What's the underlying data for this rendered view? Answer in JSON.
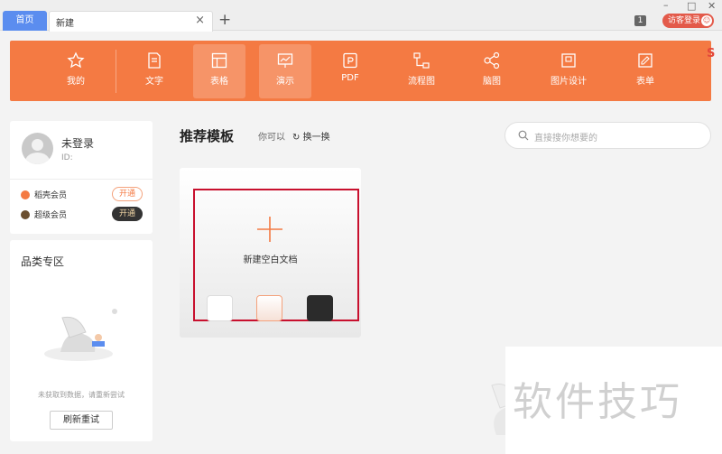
{
  "tabs": {
    "home": "首页",
    "new": "新建",
    "close": "×",
    "add": "+"
  },
  "window": {
    "badge": "1",
    "guest_label": "访客登录",
    "guest_icon": "user-icon",
    "minimize": "–",
    "maximize": "□",
    "close": "✕"
  },
  "toolbar": {
    "bg_color": "#f47a43",
    "items": [
      {
        "label": "我的",
        "icon": "star-icon"
      },
      {
        "label": "文字",
        "icon": "document-icon"
      },
      {
        "label": "表格",
        "icon": "table-icon",
        "active": true
      },
      {
        "label": "演示",
        "icon": "presentation-icon",
        "active": true
      },
      {
        "label": "PDF",
        "icon": "pdf-icon"
      },
      {
        "label": "流程图",
        "icon": "flowchart-icon"
      },
      {
        "label": "脑图",
        "icon": "mindmap-icon"
      },
      {
        "label": "图片设计",
        "icon": "image-design-icon"
      },
      {
        "label": "表单",
        "icon": "form-icon"
      }
    ]
  },
  "user": {
    "name": "未登录",
    "id_label": "ID:",
    "members": [
      {
        "label": "稻壳会员",
        "button": "开通",
        "color": "#f47a43"
      },
      {
        "label": "超级会员",
        "button": "开通",
        "color": "#6b4e2e"
      }
    ]
  },
  "category": {
    "title": "品类专区",
    "empty_text": "未获取到数据，请重新尝试",
    "refresh_button": "刷新重试"
  },
  "main": {
    "title": "推荐模板",
    "hint": "你可以",
    "swap": "换一换",
    "search_placeholder": "直接搜你想要的",
    "new_blank": "新建空白文档",
    "swatches": [
      "#ffffff",
      "#fbe6dc",
      "#2b2b2b"
    ]
  },
  "watermark": "软件技巧"
}
